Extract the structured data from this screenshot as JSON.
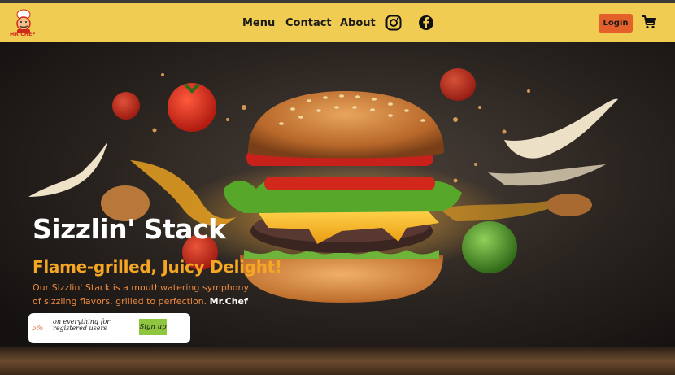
{
  "brand": {
    "logo_text": "MR CHEF"
  },
  "nav": {
    "links": [
      {
        "label": "Menu"
      },
      {
        "label": "Contact"
      },
      {
        "label": "About"
      }
    ],
    "social": [
      "instagram-icon",
      "facebook-icon"
    ],
    "login_label": "Login",
    "cart_icon": "cart-icon"
  },
  "hero": {
    "title": "Sizzlin' Stack",
    "subtitle": "Flame-grilled, Juicy Delight!",
    "description": "Our Sizzlin' Stack is a mouthwatering symphony of sizzling flavors, grilled to perfection.",
    "description_brand": "Mr.Chef"
  },
  "promo": {
    "discount": "5%",
    "text": "on everything for registered users",
    "cta_label": "Sign up"
  },
  "colors": {
    "navbar": "#f1cc52",
    "accent_orange": "#e4602a",
    "subtitle": "#f5a623",
    "signup_green": "#8ec63f"
  }
}
